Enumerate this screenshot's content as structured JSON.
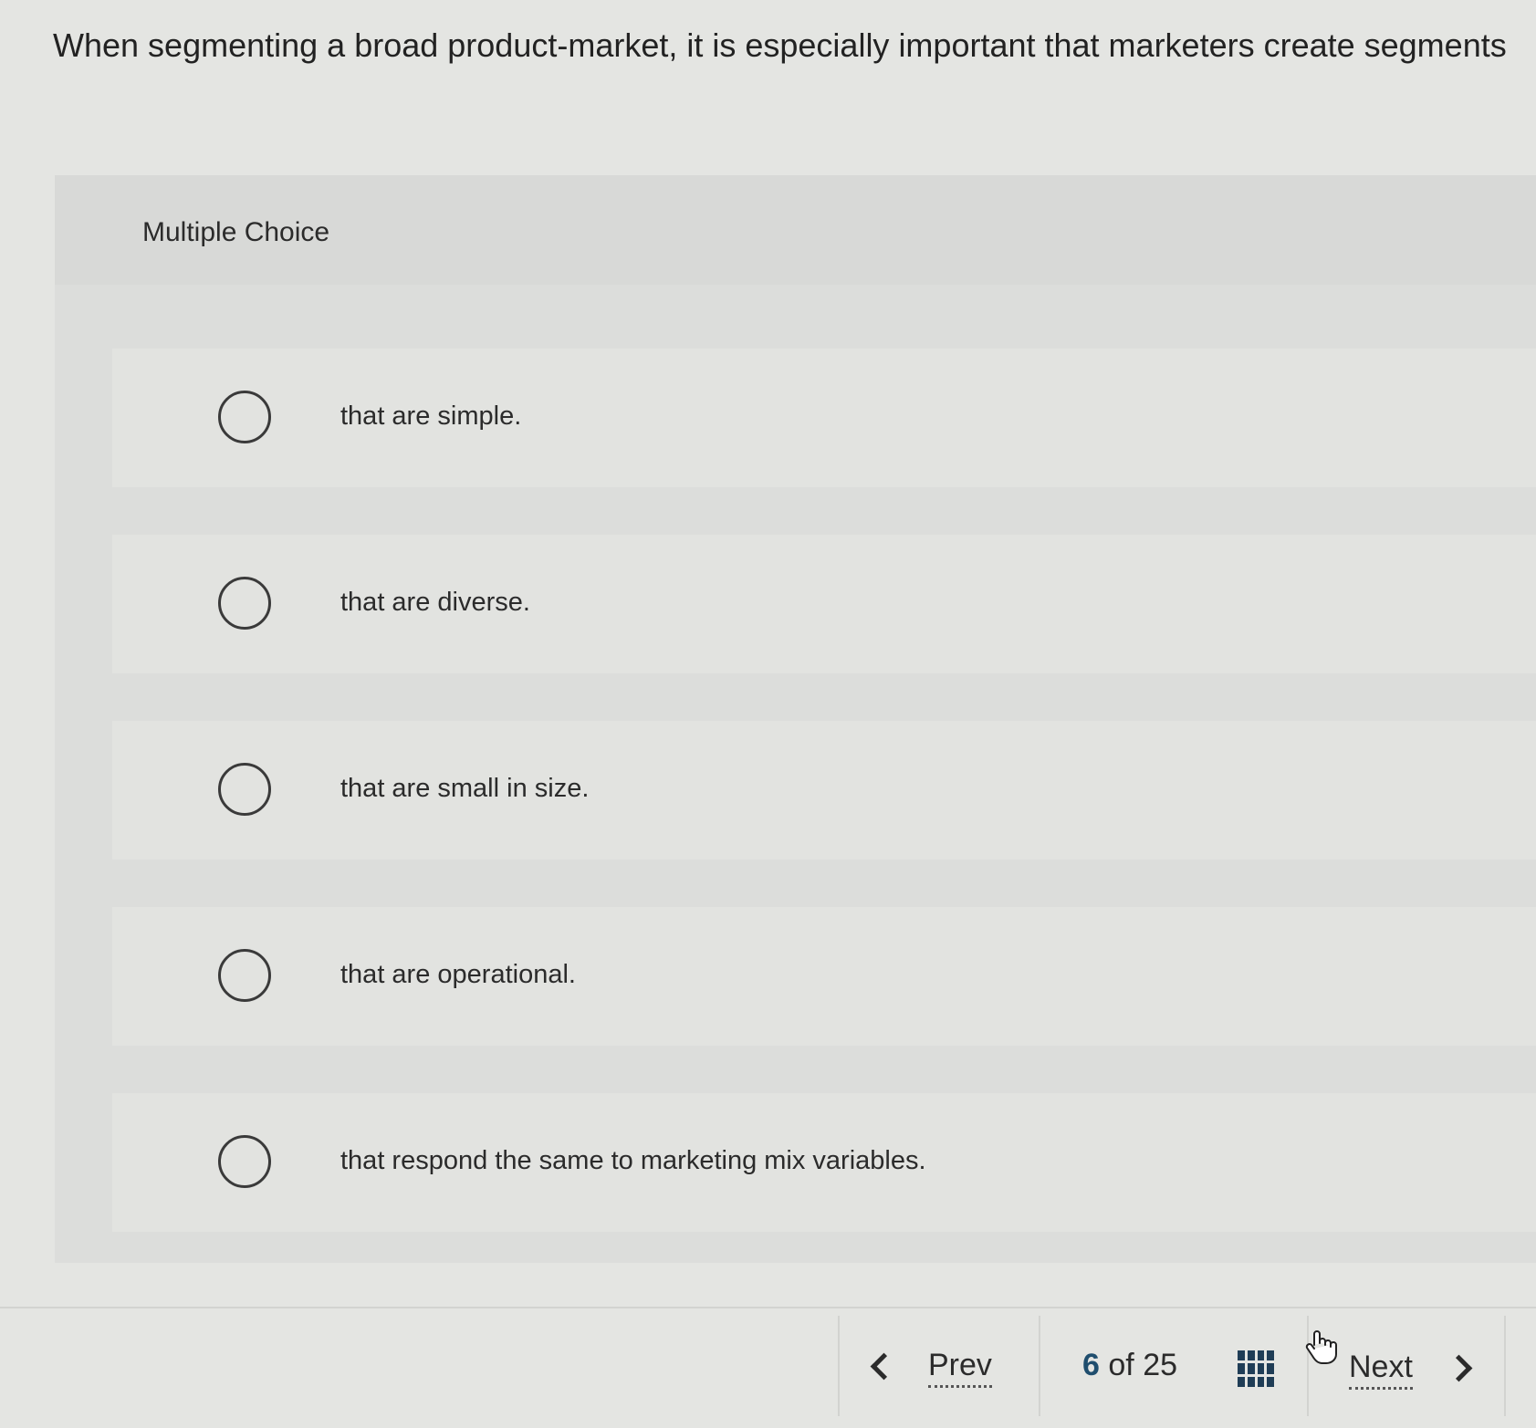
{
  "question": {
    "text": "When segmenting a broad product-market, it is especially important that marketers create segments"
  },
  "panel": {
    "type_label": "Multiple Choice"
  },
  "choices": [
    {
      "label": "that are simple."
    },
    {
      "label": "that are diverse."
    },
    {
      "label": "that are small in size."
    },
    {
      "label": "that are operational."
    },
    {
      "label": "that respond the same to marketing mix variables."
    }
  ],
  "navigation": {
    "prev_label": "Prev",
    "next_label": "Next",
    "current_page": "6",
    "of_label": "of",
    "total_pages": "25",
    "prev_icon": "chevron-left-icon",
    "next_icon": "chevron-right-icon",
    "grid_icon": "question-grid-icon"
  },
  "colors": {
    "page_indicator_current": "#1f4e6e",
    "grid_icon": "#1f3d56"
  }
}
